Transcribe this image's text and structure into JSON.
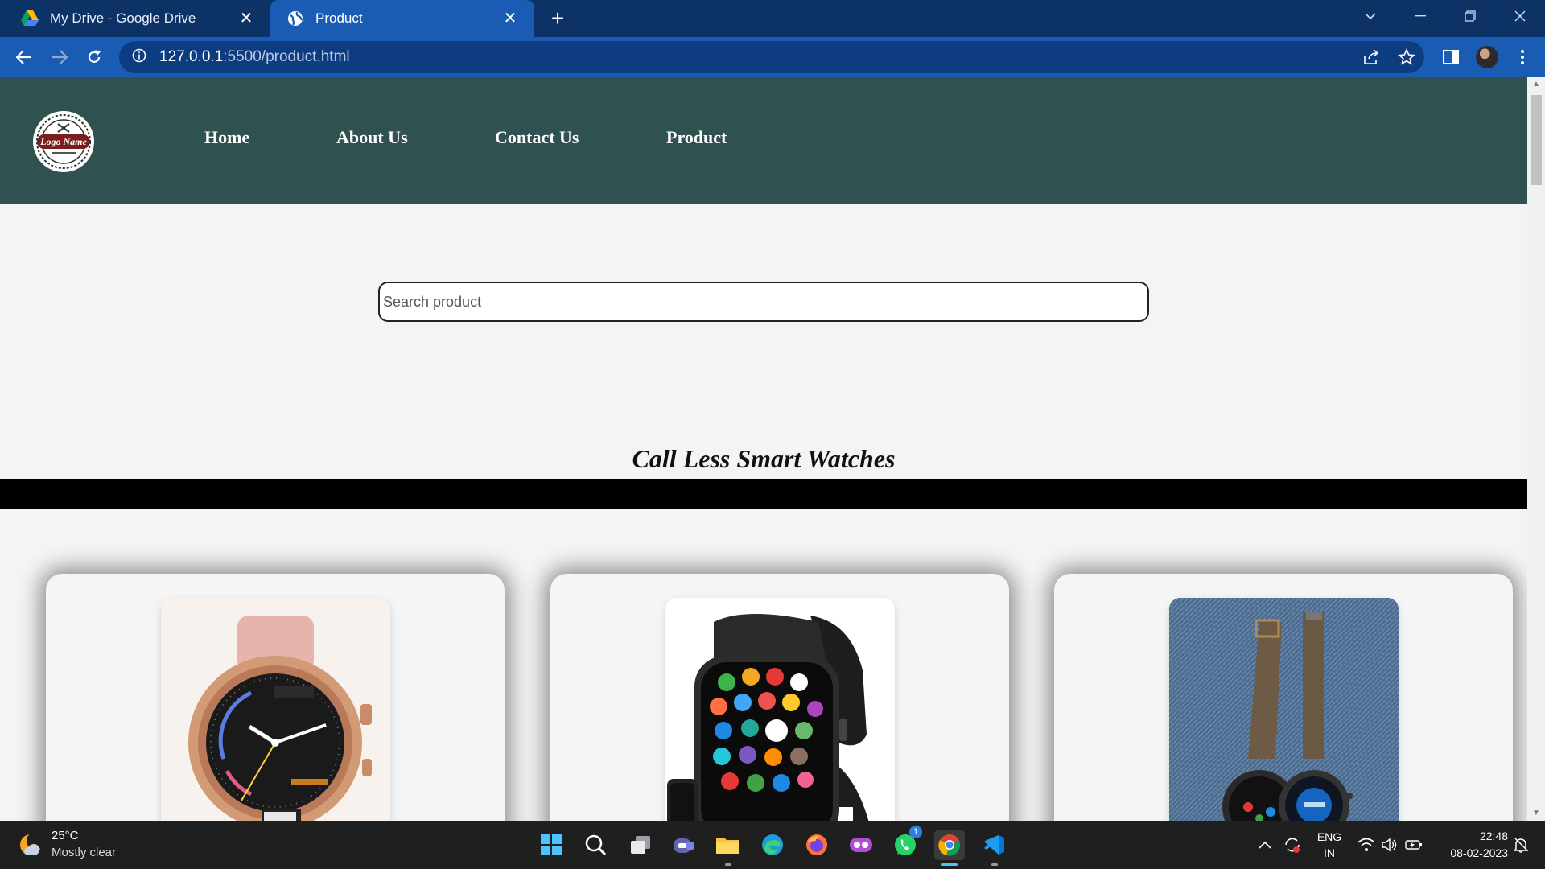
{
  "browser": {
    "tabs": [
      {
        "title": "My Drive - Google Drive",
        "icon": "google-drive-icon",
        "active": false
      },
      {
        "title": "Product",
        "icon": "globe-icon",
        "active": true
      }
    ],
    "url_host": "127.0.0.1",
    "url_path": ":5500/product.html"
  },
  "site": {
    "logo_text": "Logo Name",
    "nav": [
      "Home",
      "About Us",
      "Contact Us",
      "Product"
    ],
    "search_placeholder": "Search product",
    "section_title": "Call Less Smart Watches",
    "products": [
      {
        "image": "rose-gold-fossil-smartwatch"
      },
      {
        "image": "black-square-smartwatch"
      },
      {
        "image": "two-round-smartwatches-on-denim"
      }
    ]
  },
  "taskbar": {
    "weather_temp": "25°C",
    "weather_desc": "Mostly clear",
    "apps": [
      "start-icon",
      "search-icon",
      "task-view-icon",
      "teams-icon",
      "file-explorer-icon",
      "edge-icon",
      "firefox-icon",
      "game-app-icon",
      "whatsapp-icon",
      "chrome-icon",
      "vscode-icon"
    ],
    "whatsapp_badge": "1",
    "lang_top": "ENG",
    "lang_bottom": "IN",
    "time": "22:48",
    "date": "08-02-2023"
  },
  "colors": {
    "header_bg": "#2f5150",
    "tabstrip_bg": "#0d3366",
    "toolbar_bg": "#1a5cb3",
    "page_bg": "#f4f4f4"
  }
}
